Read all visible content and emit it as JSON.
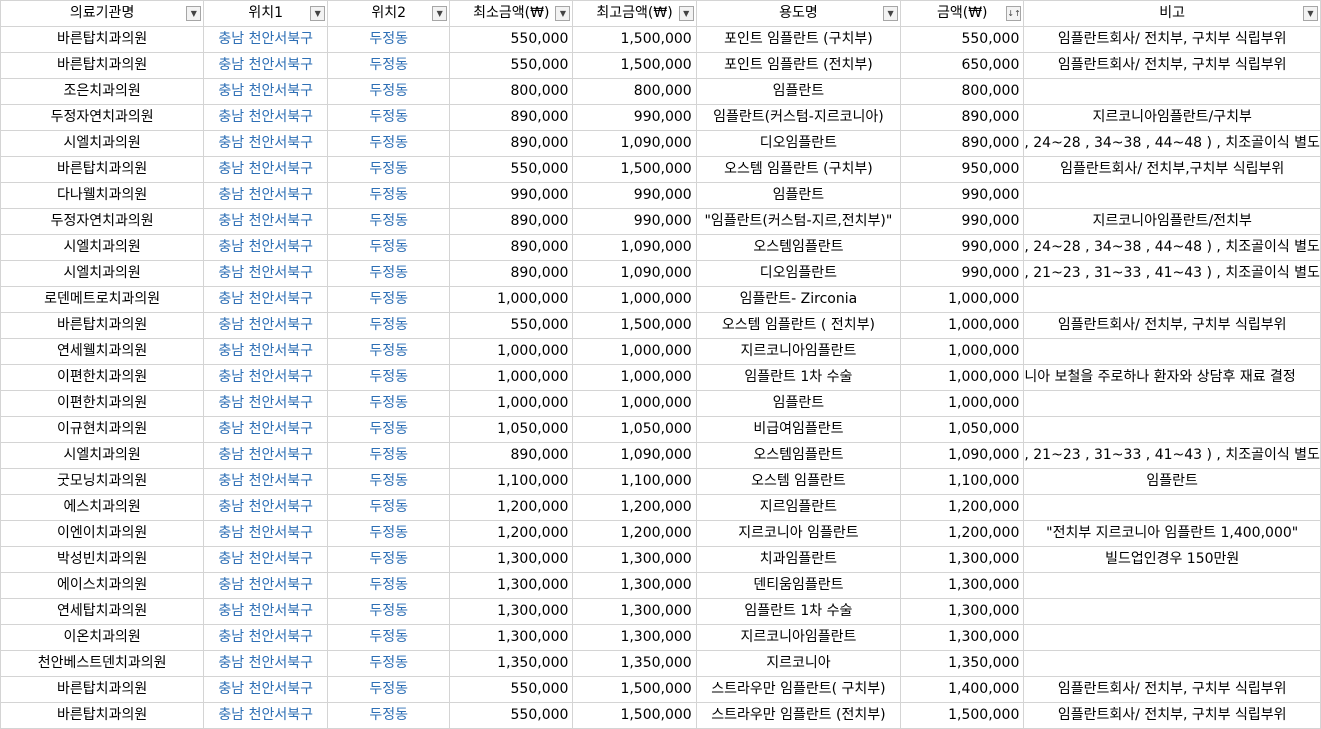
{
  "headers": [
    {
      "label": "의료기관명",
      "sort": "▼"
    },
    {
      "label": "위치1",
      "sort": "▼"
    },
    {
      "label": "위치2",
      "sort": "▼"
    },
    {
      "label": "최소금액(₩)",
      "sort": "▼"
    },
    {
      "label": "최고금액(₩)",
      "sort": "▼"
    },
    {
      "label": "용도명",
      "sort": "▼"
    },
    {
      "label": "금액(₩)",
      "sort": "↓↑"
    },
    {
      "label": "비고",
      "sort": "▼"
    }
  ],
  "rows": [
    [
      "바른탑치과의원",
      "충남 천안서북구",
      "두정동",
      "550,000",
      "1,500,000",
      "포인트 임플란트 (구치부)",
      "550,000",
      "임플란트회사/ 전치부, 구치부 식립부위"
    ],
    [
      "바른탑치과의원",
      "충남 천안서북구",
      "두정동",
      "550,000",
      "1,500,000",
      "포인트 임플란트 (전치부)",
      "650,000",
      "임플란트회사/ 전치부, 구치부 식립부위"
    ],
    [
      "조은치과의원",
      "충남 천안서북구",
      "두정동",
      "800,000",
      "800,000",
      "임플란트",
      "800,000",
      ""
    ],
    [
      "두정자연치과의원",
      "충남 천안서북구",
      "두정동",
      "890,000",
      "990,000",
      "임플란트(커스텀-지르코니아)",
      "890,000",
      "지르코니아임플란트/구치부"
    ],
    [
      "시엘치과의원",
      "충남 천안서북구",
      "두정동",
      "890,000",
      "1,090,000",
      "디오임플란트",
      "890,000",
      ", 24~28 , 34~38 , 44~48 ) , 치조골이식 별도"
    ],
    [
      "바른탑치과의원",
      "충남 천안서북구",
      "두정동",
      "550,000",
      "1,500,000",
      "오스템 임플란트 (구치부)",
      "950,000",
      "임플란트회사/ 전치부,구치부 식립부위"
    ],
    [
      "다나웰치과의원",
      "충남 천안서북구",
      "두정동",
      "990,000",
      "990,000",
      "임플란트",
      "990,000",
      ""
    ],
    [
      "두정자연치과의원",
      "충남 천안서북구",
      "두정동",
      "890,000",
      "990,000",
      "\"임플란트(커스텀-지르,전치부)\"",
      "990,000",
      "지르코니아임플란트/전치부"
    ],
    [
      "시엘치과의원",
      "충남 천안서북구",
      "두정동",
      "890,000",
      "1,090,000",
      "오스템임플란트",
      "990,000",
      ", 24~28 , 34~38 , 44~48 ) , 치조골이식 별도"
    ],
    [
      "시엘치과의원",
      "충남 천안서북구",
      "두정동",
      "890,000",
      "1,090,000",
      "디오임플란트",
      "990,000",
      ", 21~23 , 31~33 , 41~43 ) , 치조골이식 별도"
    ],
    [
      "로덴메트로치과의원",
      "충남 천안서북구",
      "두정동",
      "1,000,000",
      "1,000,000",
      "임플란트- Zirconia",
      "1,000,000",
      ""
    ],
    [
      "바른탑치과의원",
      "충남 천안서북구",
      "두정동",
      "550,000",
      "1,500,000",
      "오스템 임플란트 ( 전치부)",
      "1,000,000",
      "임플란트회사/ 전치부, 구치부 식립부위"
    ],
    [
      "연세웰치과의원",
      "충남 천안서북구",
      "두정동",
      "1,000,000",
      "1,000,000",
      "지르코니아임플란트",
      "1,000,000",
      ""
    ],
    [
      "이편한치과의원",
      "충남 천안서북구",
      "두정동",
      "1,000,000",
      "1,000,000",
      "임플란트 1차 수술",
      "1,000,000",
      "니아 보철을 주로하나 환자와 상담후 재료 결정"
    ],
    [
      "이편한치과의원",
      "충남 천안서북구",
      "두정동",
      "1,000,000",
      "1,000,000",
      "임플란트",
      "1,000,000",
      ""
    ],
    [
      "이규현치과의원",
      "충남 천안서북구",
      "두정동",
      "1,050,000",
      "1,050,000",
      "비급여임플란트",
      "1,050,000",
      ""
    ],
    [
      "시엘치과의원",
      "충남 천안서북구",
      "두정동",
      "890,000",
      "1,090,000",
      "오스템임플란트",
      "1,090,000",
      ", 21~23 , 31~33 , 41~43 ) , 치조골이식 별도"
    ],
    [
      "굿모닝치과의원",
      "충남 천안서북구",
      "두정동",
      "1,100,000",
      "1,100,000",
      "오스템 임플란트",
      "1,100,000",
      "임플란트"
    ],
    [
      "에스치과의원",
      "충남 천안서북구",
      "두정동",
      "1,200,000",
      "1,200,000",
      "지르임플란트",
      "1,200,000",
      ""
    ],
    [
      "이엔이치과의원",
      "충남 천안서북구",
      "두정동",
      "1,200,000",
      "1,200,000",
      "지르코니아 임플란트",
      "1,200,000",
      "\"전치부 지르코니아 임플란트 1,400,000\""
    ],
    [
      "박성빈치과의원",
      "충남 천안서북구",
      "두정동",
      "1,300,000",
      "1,300,000",
      "치과임플란트",
      "1,300,000",
      "빌드업인경우 150만원"
    ],
    [
      "에이스치과의원",
      "충남 천안서북구",
      "두정동",
      "1,300,000",
      "1,300,000",
      "덴티움임플란트",
      "1,300,000",
      ""
    ],
    [
      "연세탑치과의원",
      "충남 천안서북구",
      "두정동",
      "1,300,000",
      "1,300,000",
      "임플란트 1차 수술",
      "1,300,000",
      ""
    ],
    [
      "이온치과의원",
      "충남 천안서북구",
      "두정동",
      "1,300,000",
      "1,300,000",
      "지르코니아임플란트",
      "1,300,000",
      ""
    ],
    [
      "천안베스트덴치과의원",
      "충남 천안서북구",
      "두정동",
      "1,350,000",
      "1,350,000",
      "지르코니아",
      "1,350,000",
      ""
    ],
    [
      "바른탑치과의원",
      "충남 천안서북구",
      "두정동",
      "550,000",
      "1,500,000",
      "스트라우만 임플란트( 구치부)",
      "1,400,000",
      "임플란트회사/ 전치부, 구치부 식립부위"
    ],
    [
      "바른탑치과의원",
      "충남 천안서북구",
      "두정동",
      "550,000",
      "1,500,000",
      "스트라우만 임플란트 (전치부)",
      "1,500,000",
      "임플란트회사/ 전치부, 구치부 식립부위"
    ]
  ]
}
